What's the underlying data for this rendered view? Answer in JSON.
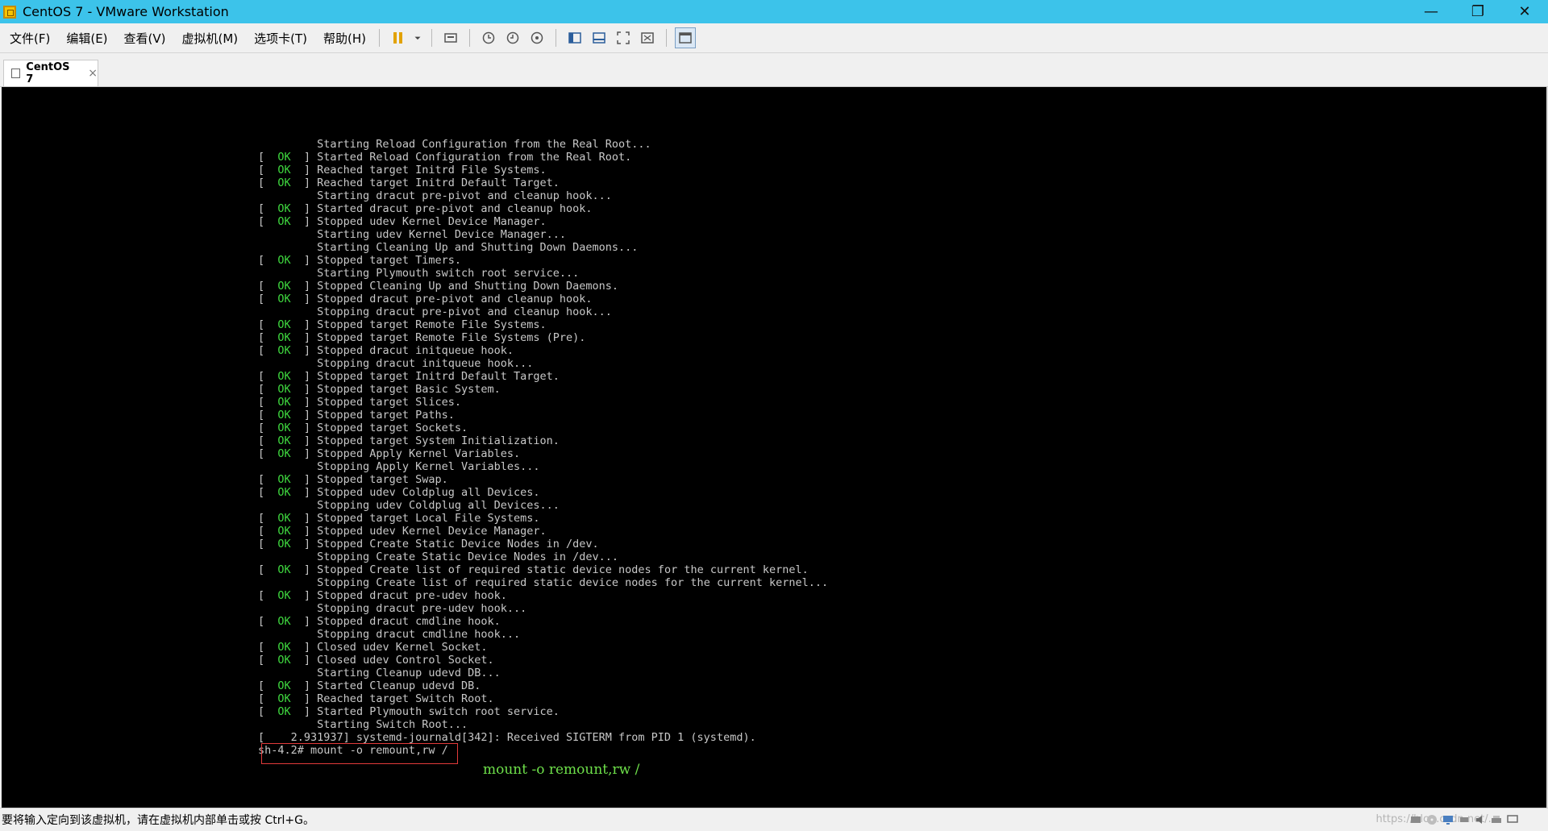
{
  "window": {
    "title": "CentOS 7 - VMware Workstation",
    "controls": [
      "minimize",
      "restore",
      "close"
    ]
  },
  "menu": {
    "items": [
      "文件(F)",
      "编辑(E)",
      "查看(V)",
      "虚拟机(M)",
      "选项卡(T)",
      "帮助(H)"
    ]
  },
  "toolbar": {
    "icons": [
      "pause-icon",
      "dropdown-icon",
      "send-keys-icon",
      "snapshot-icon",
      "revert-snapshot-icon",
      "snapshot-manager-icon",
      "library-icon",
      "console-view-icon",
      "fullscreen-icon",
      "unity-icon",
      "thumbnail-icon"
    ]
  },
  "tab": {
    "label": "CentOS 7",
    "close": "×"
  },
  "console": {
    "lines": [
      {
        "status": "",
        "text": "Starting Reload Configuration from the Real Root..."
      },
      {
        "status": "OK",
        "text": "Started Reload Configuration from the Real Root."
      },
      {
        "status": "OK",
        "text": "Reached target Initrd File Systems."
      },
      {
        "status": "OK",
        "text": "Reached target Initrd Default Target."
      },
      {
        "status": "",
        "text": "Starting dracut pre-pivot and cleanup hook..."
      },
      {
        "status": "OK",
        "text": "Started dracut pre-pivot and cleanup hook."
      },
      {
        "status": "OK",
        "text": "Stopped udev Kernel Device Manager."
      },
      {
        "status": "",
        "text": "Starting udev Kernel Device Manager..."
      },
      {
        "status": "",
        "text": "Starting Cleaning Up and Shutting Down Daemons..."
      },
      {
        "status": "OK",
        "text": "Stopped target Timers."
      },
      {
        "status": "",
        "text": "Starting Plymouth switch root service..."
      },
      {
        "status": "OK",
        "text": "Stopped Cleaning Up and Shutting Down Daemons."
      },
      {
        "status": "OK",
        "text": "Stopped dracut pre-pivot and cleanup hook."
      },
      {
        "status": "",
        "text": "Stopping dracut pre-pivot and cleanup hook..."
      },
      {
        "status": "OK",
        "text": "Stopped target Remote File Systems."
      },
      {
        "status": "OK",
        "text": "Stopped target Remote File Systems (Pre)."
      },
      {
        "status": "OK",
        "text": "Stopped dracut initqueue hook."
      },
      {
        "status": "",
        "text": "Stopping dracut initqueue hook..."
      },
      {
        "status": "OK",
        "text": "Stopped target Initrd Default Target."
      },
      {
        "status": "OK",
        "text": "Stopped target Basic System."
      },
      {
        "status": "OK",
        "text": "Stopped target Slices."
      },
      {
        "status": "OK",
        "text": "Stopped target Paths."
      },
      {
        "status": "OK",
        "text": "Stopped target Sockets."
      },
      {
        "status": "OK",
        "text": "Stopped target System Initialization."
      },
      {
        "status": "OK",
        "text": "Stopped Apply Kernel Variables."
      },
      {
        "status": "",
        "text": "Stopping Apply Kernel Variables..."
      },
      {
        "status": "OK",
        "text": "Stopped target Swap."
      },
      {
        "status": "OK",
        "text": "Stopped udev Coldplug all Devices."
      },
      {
        "status": "",
        "text": "Stopping udev Coldplug all Devices..."
      },
      {
        "status": "OK",
        "text": "Stopped target Local File Systems."
      },
      {
        "status": "OK",
        "text": "Stopped udev Kernel Device Manager."
      },
      {
        "status": "OK",
        "text": "Stopped Create Static Device Nodes in /dev."
      },
      {
        "status": "",
        "text": "Stopping Create Static Device Nodes in /dev..."
      },
      {
        "status": "OK",
        "text": "Stopped Create list of required static device nodes for the current kernel."
      },
      {
        "status": "",
        "text": "Stopping Create list of required static device nodes for the current kernel..."
      },
      {
        "status": "OK",
        "text": "Stopped dracut pre-udev hook."
      },
      {
        "status": "",
        "text": "Stopping dracut pre-udev hook..."
      },
      {
        "status": "OK",
        "text": "Stopped dracut cmdline hook."
      },
      {
        "status": "",
        "text": "Stopping dracut cmdline hook..."
      },
      {
        "status": "OK",
        "text": "Closed udev Kernel Socket."
      },
      {
        "status": "OK",
        "text": "Closed udev Control Socket."
      },
      {
        "status": "",
        "text": "Starting Cleanup udevd DB..."
      },
      {
        "status": "OK",
        "text": "Started Cleanup udevd DB."
      },
      {
        "status": "OK",
        "text": "Reached target Switch Root."
      },
      {
        "status": "OK",
        "text": "Started Plymouth switch root service."
      },
      {
        "status": "",
        "text": "Starting Switch Root..."
      }
    ],
    "journal_line": "[    2.931937] systemd-journald[342]: Received SIGTERM from PID 1 (systemd).",
    "prompt_line": "sh-4.2# mount -o remount,rw /",
    "annotation": "mount -o remount,rw /"
  },
  "status": {
    "message": "要将输入定向到该虚拟机，请在虚拟机内部单击或按 Ctrl+G。",
    "watermark": "https://blog.csdn.net/..."
  }
}
